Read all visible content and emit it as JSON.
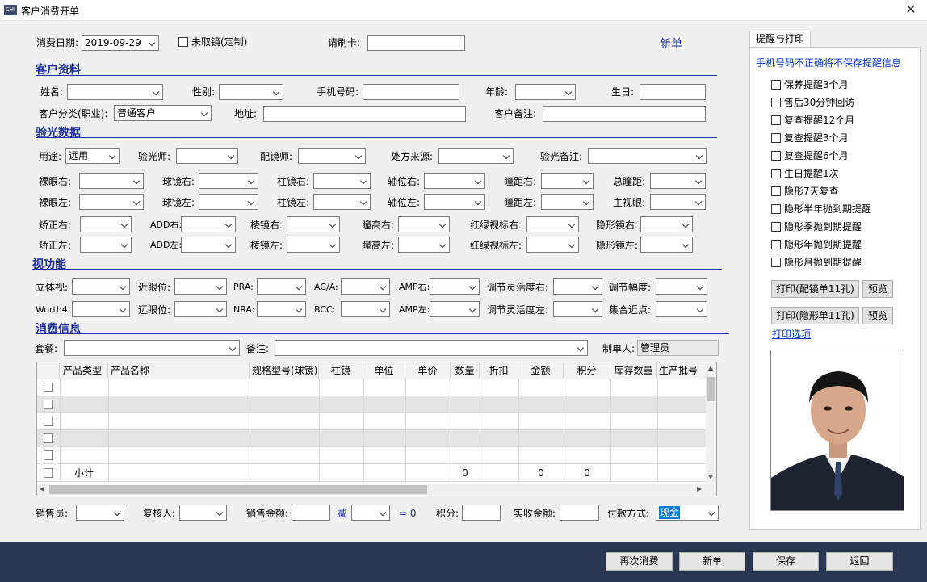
{
  "window": {
    "title": "客户消费开单",
    "icon": "app-icon"
  },
  "top": {
    "date_label": "消费日期:",
    "date_value": "2019-09-29",
    "unworn_label": "未取镜(定制)",
    "card_label": "请刷卡:",
    "new_order": "新单"
  },
  "customer": {
    "title": "客户资料",
    "name_label": "姓名:",
    "gender_label": "性别:",
    "phone_label": "手机号码:",
    "age_label": "年龄:",
    "birthday_label": "生日:",
    "category_label": "客户分类(职业):",
    "category_value": "普通客户",
    "address_label": "地址:",
    "remark_label": "客户备注:"
  },
  "optometry": {
    "title": "验光数据",
    "use_label": "用途:",
    "use_value": "远用",
    "optometrist_label": "验光师:",
    "fitter_label": "配镜师:",
    "source_label": "处方来源:",
    "remark_label": "验光备注:",
    "naked_r": "裸眼右:",
    "sph_r": "球镜右:",
    "cyl_r": "柱镜右:",
    "axis_r": "轴位右:",
    "pd_r": "瞳距右:",
    "total_pd": "总瞳距:",
    "naked_l": "裸眼左:",
    "sph_l": "球镜左:",
    "cyl_l": "柱镜左:",
    "axis_l": "轴位左:",
    "pd_l": "瞳距左:",
    "dominant": "主视眼:",
    "corr_r": "矫正右:",
    "add_r": "ADD右:",
    "prism_r": "棱镜右:",
    "ph_r": "瞳高右:",
    "rg_r": "红绿视标右:",
    "contact_r": "隐形镜右:",
    "corr_l": "矫正左:",
    "add_l": "ADD左:",
    "prism_l": "棱镜左:",
    "ph_l": "瞳高左:",
    "rg_l": "红绿视标左:",
    "contact_l": "隐形镜左:"
  },
  "vision": {
    "title": "视功能",
    "stereo": "立体视:",
    "near_pos": "近眼位:",
    "pra": "PRA:",
    "aca": "AC/A:",
    "amp_r": "AMP右:",
    "flex_r": "调节灵活度右:",
    "amplitude": "调节幅度:",
    "worth4": "Worth4:",
    "far_pos": "远眼位:",
    "nra": "NRA:",
    "bcc": "BCC:",
    "amp_l": "AMP左:",
    "flex_l": "调节灵活度左:",
    "convergence": "集合近点:"
  },
  "consume": {
    "title": "消费信息",
    "package_label": "套餐:",
    "note_label": "备注:",
    "maker_label": "制单人:",
    "maker_value": "管理员"
  },
  "table": {
    "columns": [
      "产品类型",
      "产品名称",
      "规格型号(球镜)",
      "柱镜",
      "单位",
      "单价",
      "数量",
      "折扣",
      "金额",
      "积分",
      "库存数量",
      "生产批号"
    ],
    "subtotal_label": "小计",
    "subtotal_qty": "0",
    "subtotal_amount": "0",
    "subtotal_points": "0"
  },
  "bottom": {
    "seller": "销售员:",
    "reviewer": "复核人:",
    "sale_amount": "销售金额:",
    "minus": "减",
    "eq": "= 0",
    "points": "积分:",
    "actual": "实收金额:",
    "pay_method": "付款方式:",
    "pay_value": "现金"
  },
  "buttons": {
    "again": "再次消费",
    "new": "新单",
    "save": "保存",
    "back": "返回"
  },
  "reminder": {
    "tab": "提醒与打印",
    "warning": "手机号码不正确将不保存提醒信息",
    "items": [
      "保养提醒3个月",
      "售后30分钟回访",
      "复查提醒12个月",
      "复查提醒3个月",
      "复查提醒6个月",
      "生日提醒1次",
      "隐形7天复查",
      "隐形半年抛到期提醒",
      "隐形季抛到期提醒",
      "隐形年抛到期提醒",
      "隐形月抛到期提醒"
    ],
    "print_glasses": "打印(配镜单11孔)",
    "preview1": "预览",
    "print_contact": "打印(隐形单11孔)",
    "preview2": "预览",
    "print_options": "打印选项"
  },
  "colors": {
    "section": "#1a2d9b",
    "footer": "#293752",
    "pay_highlight": "#0078d7"
  }
}
